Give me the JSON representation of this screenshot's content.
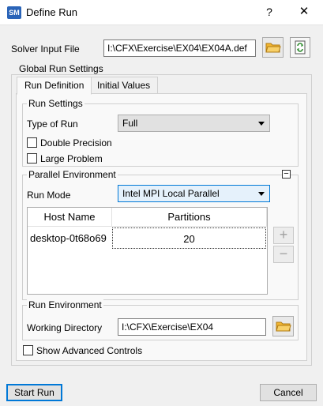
{
  "window": {
    "icon_text": "SM",
    "title": "Define Run",
    "help_glyph": "?",
    "close_glyph": "✕"
  },
  "solver_input": {
    "label": "Solver Input File",
    "value": "I:\\CFX\\Exercise\\EX04\\EX04A.def"
  },
  "global_settings": {
    "label": "Global Run Settings",
    "tabs": [
      {
        "label": "Run Definition",
        "active": true
      },
      {
        "label": "Initial Values",
        "active": false
      }
    ]
  },
  "run_settings": {
    "label": "Run Settings",
    "type_label": "Type of Run",
    "type_value": "Full",
    "double_precision_label": "Double Precision",
    "double_precision_checked": false,
    "large_problem_label": "Large Problem",
    "large_problem_checked": false
  },
  "parallel": {
    "label": "Parallel Environment",
    "collapse_glyph": "−",
    "run_mode_label": "Run Mode",
    "run_mode_value": "Intel MPI Local Parallel",
    "columns": [
      "Host Name",
      "Partitions"
    ],
    "rows": [
      {
        "host": "desktop-0t68o69",
        "partitions": "20"
      }
    ],
    "add_glyph": "+",
    "remove_glyph": "−"
  },
  "run_environment": {
    "label": "Run Environment",
    "working_dir_label": "Working Directory",
    "working_dir_value": "I:\\CFX\\Exercise\\EX04"
  },
  "advanced": {
    "label": "Show Advanced Controls",
    "checked": false
  },
  "footer": {
    "start_label": "Start Run",
    "cancel_label": "Cancel"
  },
  "colors": {
    "accent": "#0078d7",
    "folder_icon": "#f2b632",
    "reload_icon": "#2e8b2e",
    "app_icon_bg": "#2a64b8"
  }
}
